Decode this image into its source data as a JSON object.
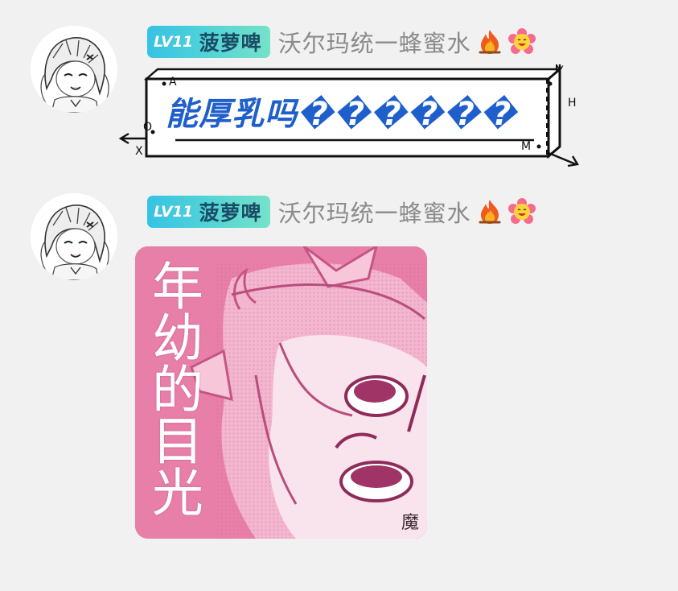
{
  "messages": [
    {
      "sender": {
        "level": "LV11",
        "badge_name": "菠萝啤",
        "display_name": "沃尔玛统一蜂蜜水",
        "emojis": [
          "fire-emoji-icon",
          "flower-emoji-icon"
        ]
      },
      "sticker": {
        "type": "text-box",
        "text": "能厚乳吗������",
        "axis_labels": [
          "A",
          "O",
          "X",
          "Y",
          "H",
          "M"
        ]
      }
    },
    {
      "sender": {
        "level": "LV11",
        "badge_name": "菠萝啤",
        "display_name": "沃尔玛统一蜂蜜水",
        "emojis": [
          "fire-emoji-icon",
          "flower-emoji-icon"
        ]
      },
      "sticker": {
        "type": "image",
        "caption": "年幼的目光",
        "signature": "魔",
        "background": "#e87fa9"
      }
    }
  ],
  "colors": {
    "badge_gradient_start": "#35c2e4",
    "badge_gradient_end": "#76e2c8",
    "badge_name": "#1b4c66",
    "sender_name": "#8b8b8b",
    "box_text": "#1f5fcc",
    "background": "#f1f1f1"
  }
}
